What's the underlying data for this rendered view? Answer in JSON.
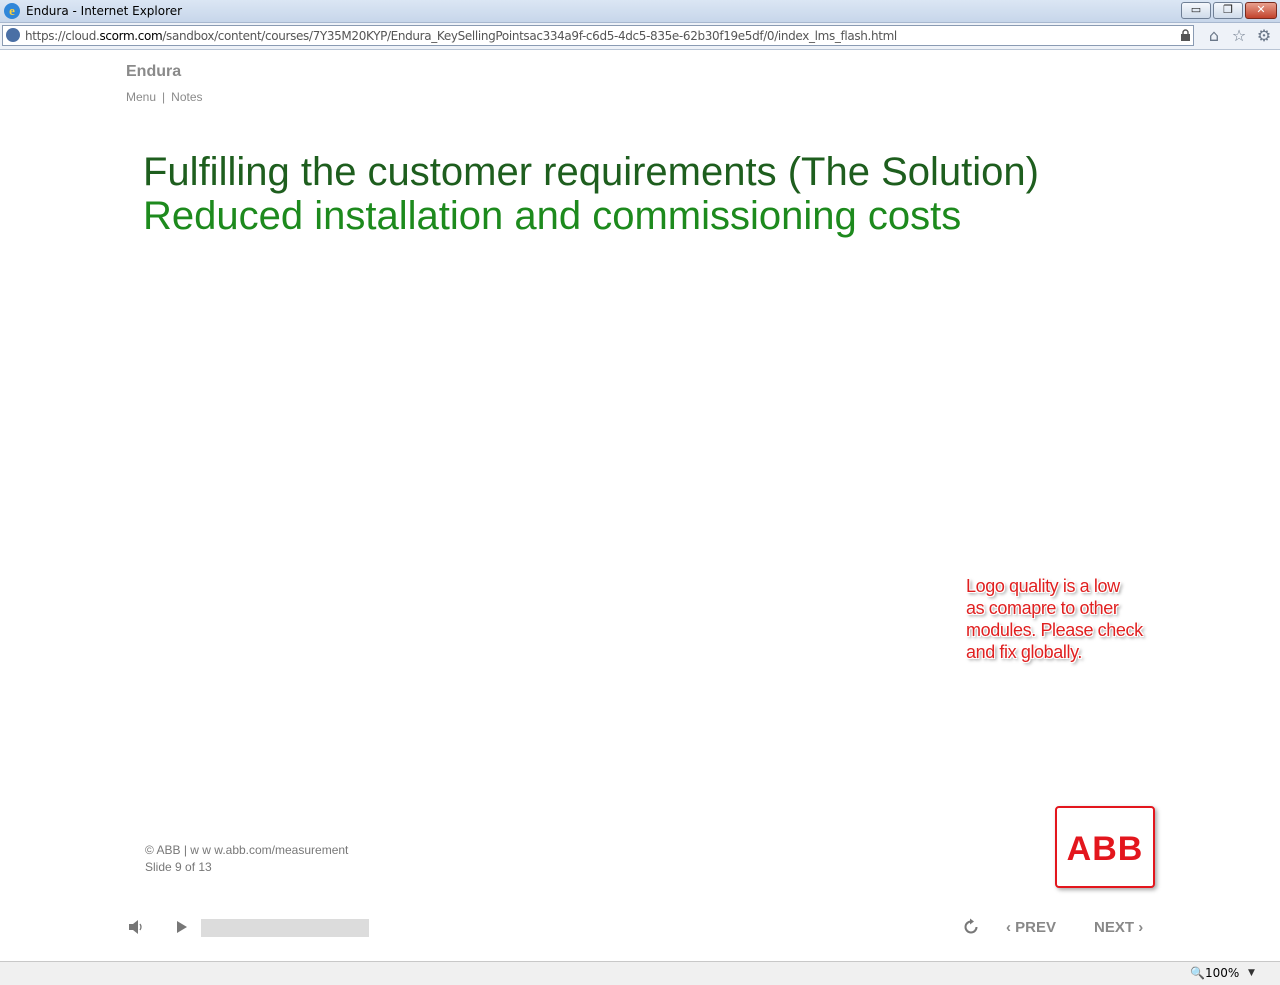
{
  "window": {
    "title": "Endura - Internet Explorer",
    "minimize": "▭",
    "restore": "❐",
    "close": "✕"
  },
  "address": {
    "url_prefix": "https://cloud.",
    "url_domain": "scorm.com",
    "url_path": "/sandbox/content/courses/7Y35M20KYP/Endura_KeySellingPointsac334a9f-c6d5-4dc5-835e-62b30f19e5df/0/index_lms_flash.html"
  },
  "toolbar": {
    "home_icon": "⌂",
    "favorites_icon": "☆",
    "settings_icon": "⚙"
  },
  "player": {
    "course_title": "Endura",
    "menu_label": "Menu",
    "separator": "|",
    "notes_label": "Notes"
  },
  "slide": {
    "heading": "Fulfilling the customer requirements (The Solution)",
    "subheading": "Reduced installation and commissioning costs",
    "review_note": [
      "Logo quality is a low",
      "as comapre to other",
      "modules. Please check",
      "and fix globally."
    ],
    "copyright": "© ABB | w w w.abb.com/measurement",
    "slide_counter": "Slide 9 of 13",
    "logo_text": "ABB"
  },
  "controls": {
    "progress": 0.0,
    "prev_label": "PREV",
    "next_label": "NEXT",
    "prev_chevron": "‹",
    "next_chevron": "›"
  },
  "statusbar": {
    "zoom": "100%",
    "zoom_dropdown": "▼"
  },
  "colors": {
    "heading": "#1e5e1e",
    "subheading": "#1d8a1d",
    "abb_red": "#e3161d",
    "note_red": "#e02020"
  }
}
